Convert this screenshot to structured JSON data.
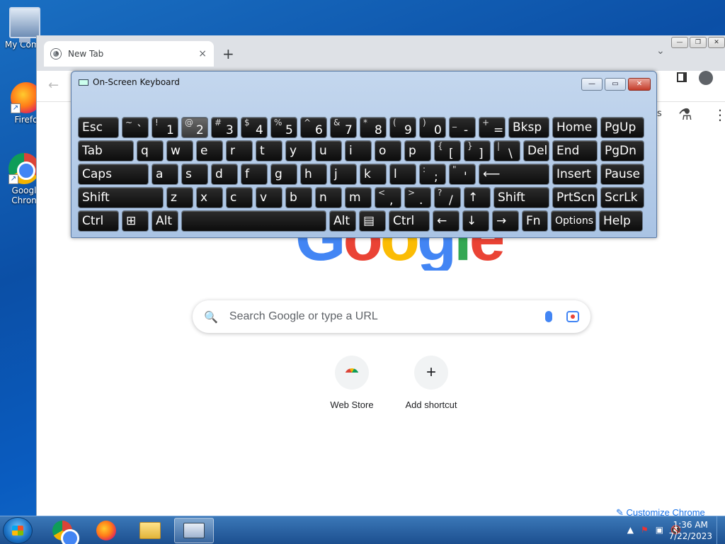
{
  "desktop": {
    "icons": [
      {
        "label": "My Comp"
      },
      {
        "label": "Firefo"
      },
      {
        "label": "Googl Chron"
      }
    ]
  },
  "chrome": {
    "tab": {
      "title": "New Tab",
      "close": "×"
    },
    "new_tab": "+",
    "tab_list": "⌄",
    "window_buttons": [
      "—",
      "❐",
      "✕"
    ],
    "back": "←",
    "partial_label": "s",
    "labs_icon": "⚗",
    "apps_icon": "⋮⋮⋮",
    "search": {
      "placeholder": "Search Google or type a URL",
      "icon": "🔍"
    },
    "shortcuts": [
      {
        "label": "Web Store"
      },
      {
        "label": "Add shortcut",
        "icon": "+"
      }
    ],
    "customize": "✎ Customize Chrome",
    "logo_letters": [
      "G",
      "o",
      "o",
      "g",
      "l",
      "e"
    ],
    "logo_colors": [
      "#4285f4",
      "#ea4335",
      "#fbbc05",
      "#4285f4",
      "#34a853",
      "#ea4335"
    ]
  },
  "osk": {
    "title": "On-Screen Keyboard",
    "buttons": [
      "—",
      "▭",
      "✕"
    ],
    "rows": [
      [
        {
          "t": "Esc",
          "w": 58
        },
        {
          "t": "~",
          "b": "`",
          "w": 38
        },
        {
          "t": "!",
          "b": "1",
          "w": 38
        },
        {
          "t": "@",
          "b": "2",
          "w": 38,
          "hover": true
        },
        {
          "t": "#",
          "b": "3",
          "w": 38
        },
        {
          "t": "$",
          "b": "4",
          "w": 38
        },
        {
          "t": "%",
          "b": "5",
          "w": 38
        },
        {
          "t": "^",
          "b": "6",
          "w": 38
        },
        {
          "t": "&",
          "b": "7",
          "w": 38
        },
        {
          "t": "*",
          "b": "8",
          "w": 38
        },
        {
          "t": "(",
          "b": "9",
          "w": 38
        },
        {
          "t": ")",
          "b": "0",
          "w": 38
        },
        {
          "t": "_",
          "b": "-",
          "w": 38
        },
        {
          "t": "+",
          "b": "=",
          "w": 38
        },
        {
          "t": "Bksp",
          "w": 58
        },
        {
          "t": "Home",
          "w": 64
        },
        {
          "t": "PgUp",
          "w": 62
        }
      ],
      [
        {
          "t": "Tab",
          "w": 79
        },
        {
          "t": "q",
          "w": 38
        },
        {
          "t": "w",
          "w": 38
        },
        {
          "t": "e",
          "w": 38
        },
        {
          "t": "r",
          "w": 38
        },
        {
          "t": "t",
          "w": 38
        },
        {
          "t": "y",
          "w": 38
        },
        {
          "t": "u",
          "w": 38
        },
        {
          "t": "i",
          "w": 38
        },
        {
          "t": "o",
          "w": 38
        },
        {
          "t": "p",
          "w": 38
        },
        {
          "t": "{",
          "b": "[",
          "w": 38
        },
        {
          "t": "}",
          "b": "]",
          "w": 38
        },
        {
          "t": "|",
          "b": "\\",
          "w": 38
        },
        {
          "t": "Del",
          "w": 37
        },
        {
          "t": "End",
          "w": 64
        },
        {
          "t": "PgDn",
          "w": 62
        }
      ],
      [
        {
          "t": "Caps",
          "w": 100
        },
        {
          "t": "a",
          "w": 38
        },
        {
          "t": "s",
          "w": 38
        },
        {
          "t": "d",
          "w": 38
        },
        {
          "t": "f",
          "w": 38
        },
        {
          "t": "g",
          "w": 38
        },
        {
          "t": "h",
          "w": 38
        },
        {
          "t": "j",
          "w": 38
        },
        {
          "t": "k",
          "w": 38
        },
        {
          "t": "l",
          "w": 38
        },
        {
          "t": ":",
          "b": ";",
          "w": 38
        },
        {
          "t": "\"",
          "b": "'",
          "w": 38
        },
        {
          "t": "⟵",
          "w": 100
        },
        {
          "t": "Insert",
          "w": 64
        },
        {
          "t": "Pause",
          "w": 62
        }
      ],
      [
        {
          "t": "Shift",
          "w": 121
        },
        {
          "t": "z",
          "w": 38
        },
        {
          "t": "x",
          "w": 38
        },
        {
          "t": "c",
          "w": 38
        },
        {
          "t": "v",
          "w": 38
        },
        {
          "t": "b",
          "w": 38
        },
        {
          "t": "n",
          "w": 38
        },
        {
          "t": "m",
          "w": 38
        },
        {
          "t": "<",
          "b": ",",
          "w": 38
        },
        {
          "t": ">",
          "b": ".",
          "w": 38
        },
        {
          "t": "?",
          "b": "/",
          "w": 38
        },
        {
          "t": "↑",
          "w": 38
        },
        {
          "t": "Shift",
          "w": 79
        },
        {
          "t": "PrtScn",
          "w": 64
        },
        {
          "t": "ScrLk",
          "w": 62
        }
      ],
      [
        {
          "t": "Ctrl",
          "w": 58
        },
        {
          "t": "⊞",
          "w": 38
        },
        {
          "t": "Alt",
          "w": 38
        },
        {
          "t": "",
          "w": 205
        },
        {
          "t": "Alt",
          "w": 38
        },
        {
          "t": "▤",
          "w": 38
        },
        {
          "t": "Ctrl",
          "w": 58
        },
        {
          "t": "←",
          "w": 38
        },
        {
          "t": "↓",
          "w": 38
        },
        {
          "t": "→",
          "w": 38
        },
        {
          "t": "Fn",
          "w": 37
        },
        {
          "t": "Options",
          "w": 64,
          "small": true
        },
        {
          "t": "Help",
          "w": 62
        }
      ]
    ]
  },
  "taskbar": {
    "clock": {
      "time": "1:36 AM",
      "date": "7/22/2023"
    },
    "tray": [
      "▲",
      "⚑",
      "▣",
      "🔇"
    ]
  }
}
